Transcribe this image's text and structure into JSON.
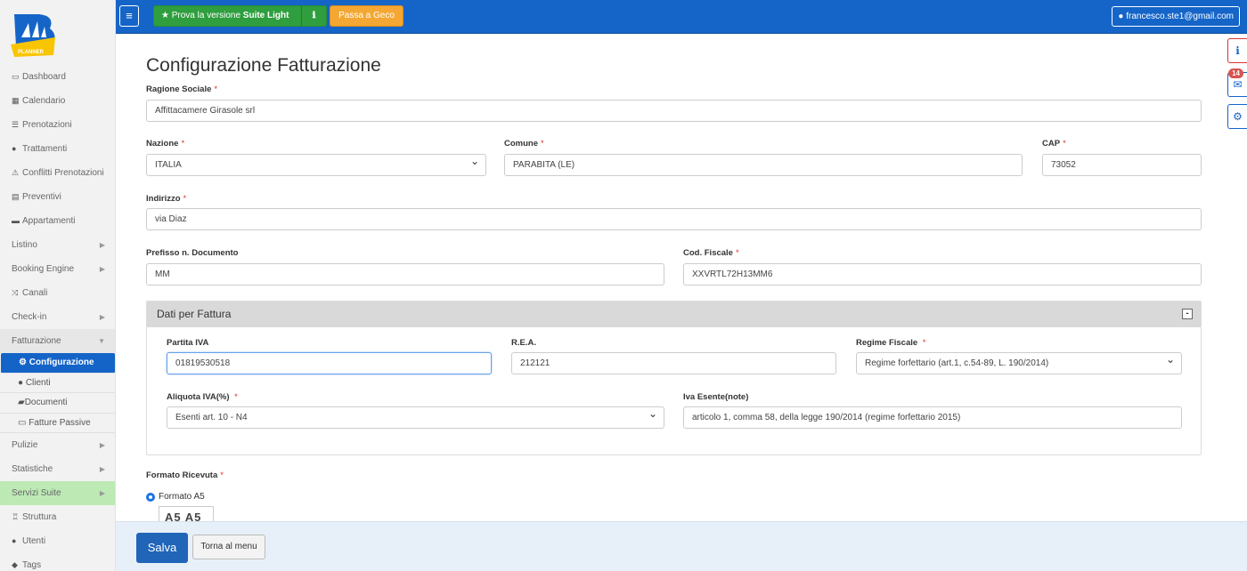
{
  "brand": {
    "logo_text": "PLANNER",
    "colors": {
      "blue": "#1565c8",
      "yellow": "#f9c400"
    }
  },
  "topbar": {
    "try_label_prefix": "Prova la versione",
    "try_label_strong": "Suite Light",
    "geco_label": "Passa a Geco",
    "user_email": "francesco.ste1@gmail.com"
  },
  "sidebar": {
    "items": [
      {
        "label": "Dashboard"
      },
      {
        "label": "Calendario"
      },
      {
        "label": "Prenotazioni"
      },
      {
        "label": "Trattamenti"
      },
      {
        "label": "Conflitti Prenotazioni"
      },
      {
        "label": "Preventivi"
      },
      {
        "label": "Appartamenti"
      },
      {
        "label": "Listino"
      },
      {
        "label": "Booking Engine"
      },
      {
        "label": "Canali"
      },
      {
        "label": "Check-in"
      },
      {
        "label": "Fatturazione"
      },
      {
        "label": "Pulizie"
      },
      {
        "label": "Statistiche"
      },
      {
        "label": "Servizi Suite"
      },
      {
        "label": "Struttura"
      },
      {
        "label": "Utenti"
      },
      {
        "label": "Tags"
      }
    ],
    "sub_items": [
      {
        "label": "Configurazione"
      },
      {
        "label": "Clienti"
      },
      {
        "label": "Documenti"
      },
      {
        "label": "Fatture Passive"
      }
    ]
  },
  "side_tools": {
    "badge_count": "14"
  },
  "page": {
    "title": "Configurazione Fatturazione",
    "ragione_sociale": {
      "label": "Ragione Sociale",
      "value": "Affittacamere Girasole srl"
    },
    "nazione": {
      "label": "Nazione",
      "value": "ITALIA"
    },
    "comune": {
      "label": "Comune",
      "value": "PARABITA (LE)"
    },
    "cap": {
      "label": "CAP",
      "value": "73052"
    },
    "indirizzo": {
      "label": "Indirizzo",
      "value": "via Diaz"
    },
    "prefisso": {
      "label": "Prefisso n. Documento",
      "value": "MM"
    },
    "cod_fiscale": {
      "label": "Cod. Fiscale",
      "value": "XXVRTL72H13MM6"
    },
    "panel": {
      "title": "Dati per Fattura",
      "collapse_symbol": "-",
      "partita_iva": {
        "label": "Partita IVA",
        "value": "01819530518"
      },
      "rea": {
        "label": "R.E.A.",
        "value": "212121"
      },
      "regime": {
        "label": "Regime Fiscale",
        "value": "Regime forfettario (art.1, c.54-89, L. 190/2014)"
      },
      "aliquota": {
        "label": "Aliquota IVA(%)",
        "value": "Esenti art. 10 - N4"
      },
      "iva_esente": {
        "label": "Iva Esente(note)",
        "value": "articolo 1, comma 58, della legge 190/2014 (regime forfettario 2015)"
      }
    },
    "formato": {
      "label": "Formato Ricevuta",
      "option": "Formato A5",
      "preview": "A5 A5"
    }
  },
  "footer": {
    "save_label": "Salva",
    "back_label": "Torna al menu"
  }
}
